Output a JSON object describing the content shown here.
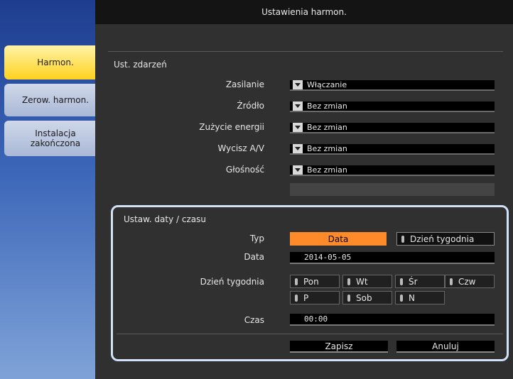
{
  "title": "Ustawienia harmon.",
  "sidebar": {
    "items": [
      {
        "label": "Harmon."
      },
      {
        "label": "Zerow. harmon."
      },
      {
        "label": "Instalacja\nzakończona"
      }
    ]
  },
  "events": {
    "section_title": "Ust. zdarzeń",
    "rows": [
      {
        "label": "Zasilanie",
        "value": "Włączanie"
      },
      {
        "label": "Źródło",
        "value": "Bez zmian"
      },
      {
        "label": "Zużycie energii",
        "value": "Bez zmian"
      },
      {
        "label": "Wycisz A/V",
        "value": "Bez zmian"
      },
      {
        "label": "Głośność",
        "value": "Bez zmian"
      }
    ]
  },
  "datetime": {
    "section_title": "Ustaw. daty / czasu",
    "type_label": "Typ",
    "type_options": [
      "Data",
      "Dzień tygodnia"
    ],
    "date_label": "Data",
    "date_value": "2014-05-05",
    "weekday_label": "Dzień tygodnia",
    "weekdays": [
      "Pon",
      "Wt",
      "Śr",
      "Czw",
      "P",
      "Sob",
      "N"
    ],
    "time_label": "Czas",
    "time_value": "00:00"
  },
  "actions": {
    "save": "Zapisz",
    "cancel": "Anuluj"
  }
}
